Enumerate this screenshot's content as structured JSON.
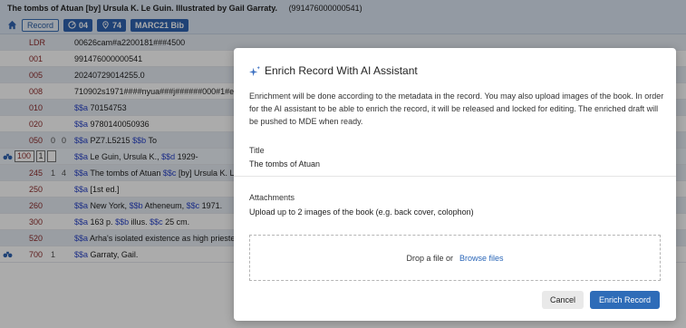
{
  "header": {
    "title": "The tombs of Atuan [by] Ursula K. Le Guin. Illustrated by Gail Garraty.",
    "record_id": "(991476000000541)",
    "record_btn": "Record",
    "badge1": "04",
    "badge2": "74",
    "badge3": "MARC21 Bib"
  },
  "rows": [
    {
      "tag": "LDR",
      "ind1": "",
      "ind2": "",
      "parts": [
        [
          "00626cam#a2200181###4500",
          ""
        ]
      ]
    },
    {
      "tag": "001",
      "ind1": "",
      "ind2": "",
      "parts": [
        [
          "991476000000541",
          ""
        ]
      ]
    },
    {
      "tag": "005",
      "ind1": "",
      "ind2": "",
      "parts": [
        [
          "20240729014255.0",
          ""
        ]
      ]
    },
    {
      "tag": "008",
      "ind1": "",
      "ind2": "",
      "parts": [
        [
          "710902s1971####nyua###j######000#1#e",
          ""
        ]
      ]
    },
    {
      "tag": "010",
      "ind1": "",
      "ind2": "",
      "parts": [
        [
          "$$a",
          "sub"
        ],
        [
          " 70154753",
          ""
        ]
      ]
    },
    {
      "tag": "020",
      "ind1": "",
      "ind2": "",
      "parts": [
        [
          "$$a",
          "sub"
        ],
        [
          " 9780140050936",
          ""
        ]
      ]
    },
    {
      "tag": "050",
      "ind1": "0",
      "ind2": "0",
      "parts": [
        [
          "$$a",
          "sub"
        ],
        [
          " PZ7.L5215 ",
          ""
        ],
        [
          "$$b",
          "sub"
        ],
        [
          " To",
          ""
        ]
      ]
    },
    {
      "tag": "100",
      "ind1": "1",
      "ind2": "",
      "parts": [
        [
          "$$a",
          "sub"
        ],
        [
          " Le Guin, Ursula K., ",
          ""
        ],
        [
          "$$d",
          "sub"
        ],
        [
          " 1929-",
          ""
        ]
      ]
    },
    {
      "tag": "245",
      "ind1": "1",
      "ind2": "4",
      "parts": [
        [
          "$$a",
          "sub"
        ],
        [
          " The tombs of Atuan ",
          ""
        ],
        [
          "$$c",
          "sub"
        ],
        [
          " [by] Ursula K. L",
          ""
        ]
      ]
    },
    {
      "tag": "250",
      "ind1": "",
      "ind2": "",
      "parts": [
        [
          "$$a",
          "sub"
        ],
        [
          " [1st ed.]",
          ""
        ]
      ]
    },
    {
      "tag": "260",
      "ind1": "",
      "ind2": "",
      "parts": [
        [
          "$$a",
          "sub"
        ],
        [
          " New York, ",
          ""
        ],
        [
          "$$b",
          "sub"
        ],
        [
          " Atheneum, ",
          ""
        ],
        [
          "$$c",
          "sub"
        ],
        [
          " 1971.",
          ""
        ]
      ]
    },
    {
      "tag": "300",
      "ind1": "",
      "ind2": "",
      "parts": [
        [
          "$$a",
          "sub"
        ],
        [
          " 163 p. ",
          ""
        ],
        [
          "$$b",
          "sub"
        ],
        [
          " illus. ",
          ""
        ],
        [
          "$$c",
          "sub"
        ],
        [
          " 25 cm.",
          ""
        ]
      ]
    },
    {
      "tag": "520",
      "ind1": "",
      "ind2": "",
      "parts": [
        [
          "$$a",
          "sub"
        ],
        [
          " Arha's isolated existence as high prieste",
          ""
        ]
      ]
    },
    {
      "tag": "700",
      "ind1": "1",
      "ind2": "",
      "parts": [
        [
          "$$a",
          "sub"
        ],
        [
          " Garraty, Gail.",
          ""
        ]
      ]
    }
  ],
  "dialog": {
    "title": "Enrich Record With AI Assistant",
    "description": "Enrichment will be done according to the metadata in the record. You may also upload images of the book. In order for the AI assistant to be able to enrich the record, it will be released and locked for editing. The enriched draft will be pushed to MDE when ready.",
    "title_label": "Title",
    "title_value": "The tombs of Atuan",
    "attachments_label": "Attachments",
    "attachments_hint": "Upload up to 2 images of the book (e.g. back cover, colophon)",
    "drop_text": "Drop a file or",
    "browse_text": "Browse files",
    "cancel_label": "Cancel",
    "enrich_label": "Enrich Record"
  }
}
